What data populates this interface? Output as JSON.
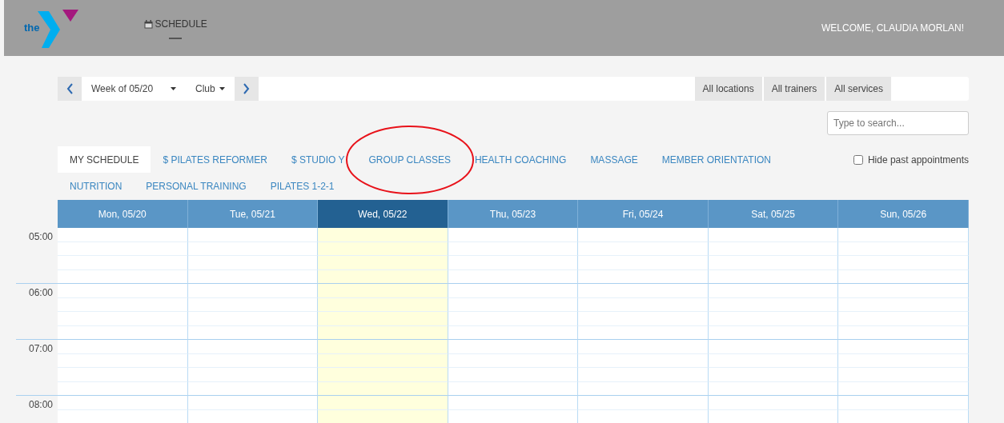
{
  "header": {
    "logo_text": "the",
    "nav": [
      {
        "label": "SCHEDULE",
        "selected": true
      }
    ],
    "welcome": "WELCOME, CLAUDIA MORLAN!"
  },
  "toolbar": {
    "week": "Week of 05/20",
    "view": "Club",
    "filters": [
      "All locations",
      "All trainers",
      "All services"
    ]
  },
  "search": {
    "placeholder": "Type to search..."
  },
  "tab_rows": [
    [
      {
        "label": "MY SCHEDULE",
        "selected": true
      },
      {
        "label": "$ PILATES REFORMER",
        "selected": false
      },
      {
        "label": "$ STUDIO Y",
        "selected": false
      },
      {
        "label": "GROUP CLASSES",
        "selected": false
      },
      {
        "label": "HEALTH COACHING",
        "selected": false
      },
      {
        "label": "MASSAGE",
        "selected": false
      },
      {
        "label": "MEMBER ORIENTATION",
        "selected": false
      }
    ],
    [
      {
        "label": "NUTRITION",
        "selected": false
      },
      {
        "label": "PERSONAL TRAINING",
        "selected": false
      },
      {
        "label": "PILATES 1-2-1",
        "selected": false
      }
    ]
  ],
  "hide_past": {
    "label": "Hide past appointments",
    "checked": false
  },
  "calendar": {
    "days": [
      {
        "label": "Mon, 05/20",
        "today": false
      },
      {
        "label": "Tue, 05/21",
        "today": false
      },
      {
        "label": "Wed, 05/22",
        "today": true
      },
      {
        "label": "Thu, 05/23",
        "today": false
      },
      {
        "label": "Fri, 05/24",
        "today": false
      },
      {
        "label": "Sat, 05/25",
        "today": false
      },
      {
        "label": "Sun, 05/26",
        "today": false
      }
    ],
    "hours": [
      "05:00",
      "06:00",
      "07:00",
      "08:00"
    ]
  },
  "annotation": {
    "kind": "ellipse"
  }
}
